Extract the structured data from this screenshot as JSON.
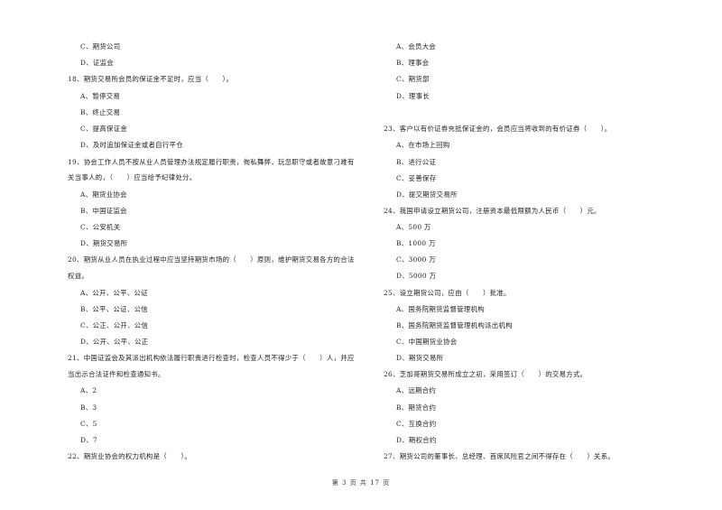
{
  "left_column": [
    {
      "type": "option",
      "text": "C、期货公司"
    },
    {
      "type": "option",
      "text": "D、证监会"
    },
    {
      "type": "question",
      "text": "18、期货交易所会员的保证金不足时，应当（　　）。"
    },
    {
      "type": "option",
      "text": "A、暂停交易"
    },
    {
      "type": "option",
      "text": "B、终止交易"
    },
    {
      "type": "option",
      "text": "C、提高保证金"
    },
    {
      "type": "option",
      "text": "D、及时追加保证金或者自行平仓"
    },
    {
      "type": "question",
      "text": "19、协会工作人员不按从业人员管理办法规定履行职责，徇私舞弊、玩忽职守或者故意刁难有"
    },
    {
      "type": "question_cont",
      "text": "关当事人的，（　　）应当给予纪律处分。"
    },
    {
      "type": "option",
      "text": "A、期货业协会"
    },
    {
      "type": "option",
      "text": "B、中国证监会"
    },
    {
      "type": "option",
      "text": "C、公安机关"
    },
    {
      "type": "option",
      "text": "D、期货交易所"
    },
    {
      "type": "question",
      "text": "20、期货从业人员在执业过程中应当坚持期货市场的（　　）原则，维护期货交易各方的合法"
    },
    {
      "type": "question_cont",
      "text": "权益。"
    },
    {
      "type": "option",
      "text": "A、公开、公平、公证"
    },
    {
      "type": "option",
      "text": "B、公平、公证、公信"
    },
    {
      "type": "option",
      "text": "C、公正、公开、公信"
    },
    {
      "type": "option",
      "text": "D、公开、公平、公正"
    },
    {
      "type": "question",
      "text": "21、中国证监会及其派出机构依法履行职责进行检查时，检查人员不得少于（　　）人，并应"
    },
    {
      "type": "question_cont",
      "text": "当出示合法证件和检查通知书。"
    },
    {
      "type": "option",
      "text": "A、2"
    },
    {
      "type": "option",
      "text": "B、3"
    },
    {
      "type": "option",
      "text": "C、5"
    },
    {
      "type": "option",
      "text": "D、7"
    },
    {
      "type": "question",
      "text": "22、期货业协会的权力机构是（　　）。"
    }
  ],
  "right_column": [
    {
      "type": "option",
      "text": "A、会员大会"
    },
    {
      "type": "option",
      "text": "B、理事会"
    },
    {
      "type": "option",
      "text": "C、期货部"
    },
    {
      "type": "option",
      "text": "D、理事长"
    },
    {
      "type": "question",
      "text": "23、客户以有价证券充抵保证金的，会员应当将收到的有价证券（　　）。"
    },
    {
      "type": "option",
      "text": "A、在市场上回购"
    },
    {
      "type": "option",
      "text": "B、进行公证"
    },
    {
      "type": "option",
      "text": "C、妥善保存"
    },
    {
      "type": "option",
      "text": "D、提交期货交易所"
    },
    {
      "type": "question",
      "text": "24、我国申请设立期货公司，注册资本最低限额为人民币（　　）元。"
    },
    {
      "type": "option",
      "text": "A、500 万"
    },
    {
      "type": "option",
      "text": "B、1000 万"
    },
    {
      "type": "option",
      "text": "C、3000 万"
    },
    {
      "type": "option",
      "text": "D、5000 万"
    },
    {
      "type": "question",
      "text": "25、设立期货公司，应由（　　）批准。"
    },
    {
      "type": "option",
      "text": "A、国务院期货监督管理机构"
    },
    {
      "type": "option",
      "text": "B、国务院期货监督管理机构派出机构"
    },
    {
      "type": "option",
      "text": "C、中国期货业协会"
    },
    {
      "type": "option",
      "text": "D、期货交易所"
    },
    {
      "type": "question",
      "text": "26、芝加哥期货交易所成立之初，采用签订（　　）的交易方式。"
    },
    {
      "type": "option",
      "text": "A、远期合约"
    },
    {
      "type": "option",
      "text": "B、期货合约"
    },
    {
      "type": "option",
      "text": "C、互换合约"
    },
    {
      "type": "option",
      "text": "D、期权合约"
    },
    {
      "type": "question",
      "text": "27、期货公司的董事长、总经理、首席风险官之间不得存在（　　）关系。"
    }
  ],
  "footer": {
    "page_label": "第 3 页 共 17 页"
  }
}
